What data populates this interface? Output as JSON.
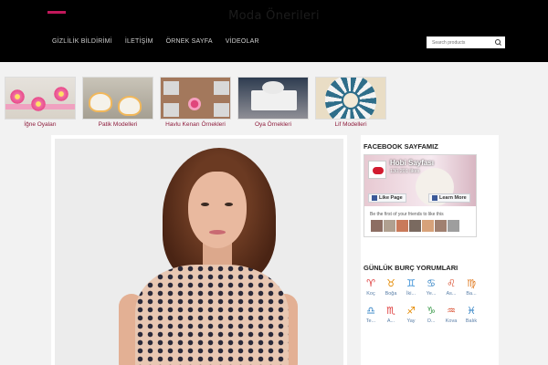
{
  "header": {
    "site_title": "Moda Önerileri",
    "nav": [
      "GİZLİLİK BİLDİRİMİ",
      "İLETİŞİM",
      "ÖRNEK SAYFA",
      "VİDEOLAR"
    ],
    "search_placeholder": "Search products",
    "accent_color": "#c2185b"
  },
  "categories": [
    {
      "label": "İğne Oyaları",
      "icon": "needle-lace-thumbnail"
    },
    {
      "label": "Patik Modelleri",
      "icon": "booties-thumbnail"
    },
    {
      "label": "Havlu Kenarı Örnekleri",
      "icon": "towel-edge-thumbnail"
    },
    {
      "label": "Oya Örnekleri",
      "icon": "lace-thumbnail"
    },
    {
      "label": "Lif Modelleri",
      "icon": "doily-thumbnail"
    }
  ],
  "sidebar": {
    "facebook_title": "FACEBOOK SAYFAMIZ",
    "fb_page_name": "Hobi Sayfası",
    "fb_likes": "130.201 likes",
    "fb_like_button": "Like Page",
    "fb_learn_button": "Learn More",
    "fb_friends_text": "Be the first of your friends to like this",
    "fb_color": "#3b5998",
    "horoscope_title": "GÜNLÜK BURÇ YORUMLARI",
    "zodiac_row1": [
      {
        "label": "Koç",
        "glyph": "♈"
      },
      {
        "label": "Boğa",
        "glyph": "♉"
      },
      {
        "label": "İki...",
        "glyph": "♊"
      },
      {
        "label": "Ye...",
        "glyph": "♋"
      },
      {
        "label": "As...",
        "glyph": "♌"
      },
      {
        "label": "Ba...",
        "glyph": "♍"
      }
    ],
    "zodiac_row2": [
      {
        "label": "Te...",
        "glyph": "♎"
      },
      {
        "label": "A...",
        "glyph": "♏"
      },
      {
        "label": "Yay",
        "glyph": "♐"
      },
      {
        "label": "O...",
        "glyph": "♑"
      },
      {
        "label": "Kova",
        "glyph": "♒"
      },
      {
        "label": "Balık",
        "glyph": "♓"
      }
    ]
  }
}
